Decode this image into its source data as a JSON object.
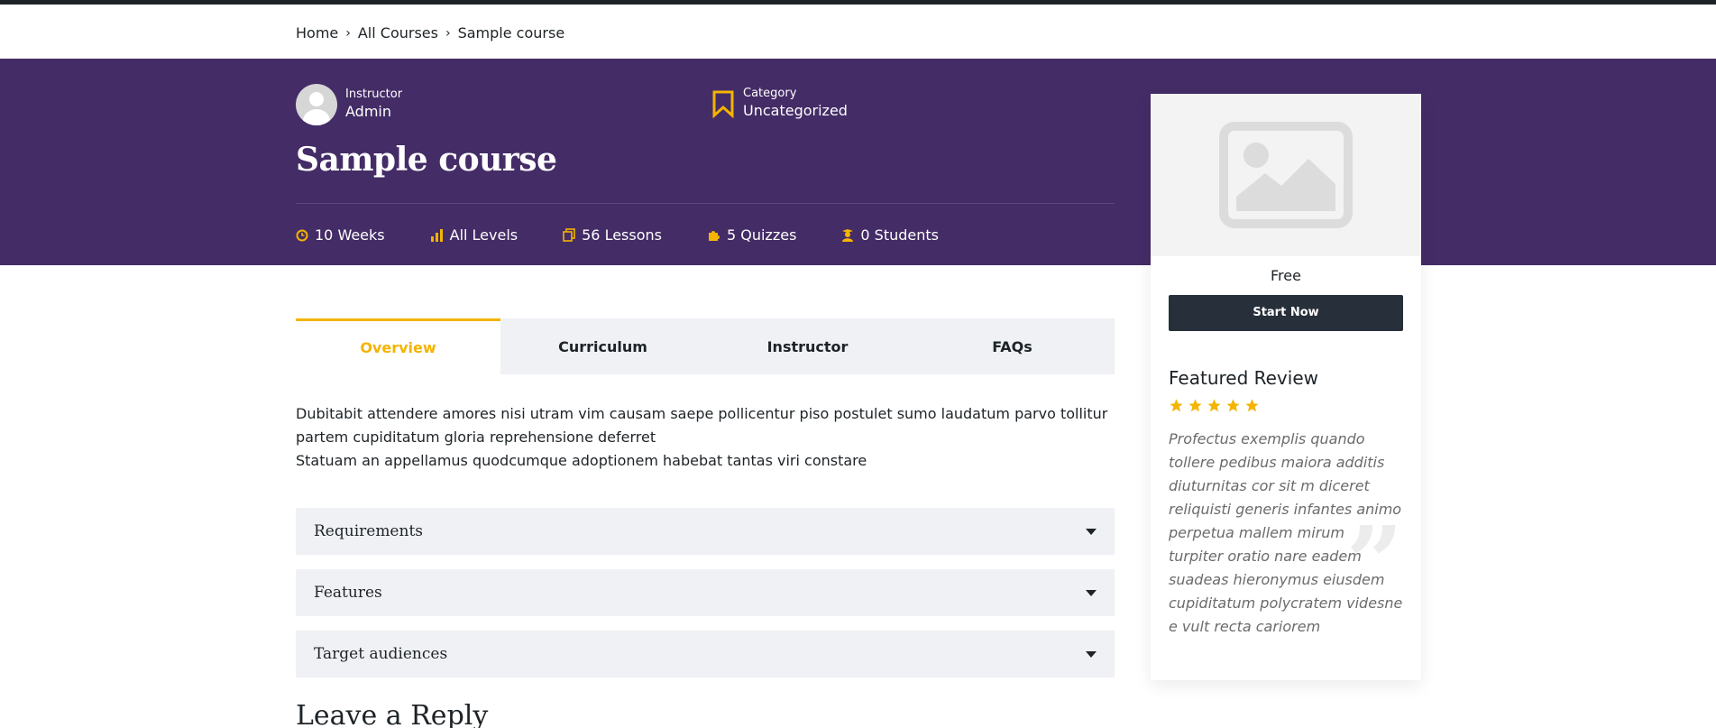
{
  "breadcrumb": [
    "Home",
    "All Courses",
    "Sample course"
  ],
  "instructor": {
    "label": "Instructor",
    "name": "Admin"
  },
  "category": {
    "label": "Category",
    "value": "Uncategorized"
  },
  "course": {
    "title": "Sample course"
  },
  "stats": [
    {
      "icon": "clock-icon",
      "text": "10 Weeks"
    },
    {
      "icon": "level-bars-icon",
      "text": "All Levels"
    },
    {
      "icon": "lessons-icon",
      "text": "56 Lessons"
    },
    {
      "icon": "puzzle-icon",
      "text": "5 Quizzes"
    },
    {
      "icon": "students-icon",
      "text": "0 Students"
    }
  ],
  "tabs": [
    {
      "label": "Overview",
      "active": true
    },
    {
      "label": "Curriculum",
      "active": false
    },
    {
      "label": "Instructor",
      "active": false
    },
    {
      "label": "FAQs",
      "active": false
    }
  ],
  "overview": {
    "line1": "Dubitabit attendere amores nisi utram vim causam saepe pollicentur piso postulet sumo laudatum parvo tollitur partem cupiditatum gloria reprehensione deferret",
    "line2": "Statuam an appellamus quodcumque adoptionem habebat tantas viri constare"
  },
  "accordions": [
    "Requirements",
    "Features",
    "Target audiences"
  ],
  "leave_reply": "Leave a Reply",
  "sidebar": {
    "price": "Free",
    "start_button": "Start Now",
    "featured_title": "Featured Review",
    "rating": 5,
    "review": "Profectus exemplis quando tollere pedibus maiora additis diuturnitas cor sit m diceret reliquisti generis infantes animo perpetua mallem mirum turpiter oratio nare eadem suadeas hieronymus eiusdem cupiditatum polycratem videsne e vult recta cariorem"
  },
  "colors": {
    "hero": "#442c66",
    "accent": "#f4b400",
    "button": "#272f3b",
    "tab_bg": "#f0f1f5"
  }
}
